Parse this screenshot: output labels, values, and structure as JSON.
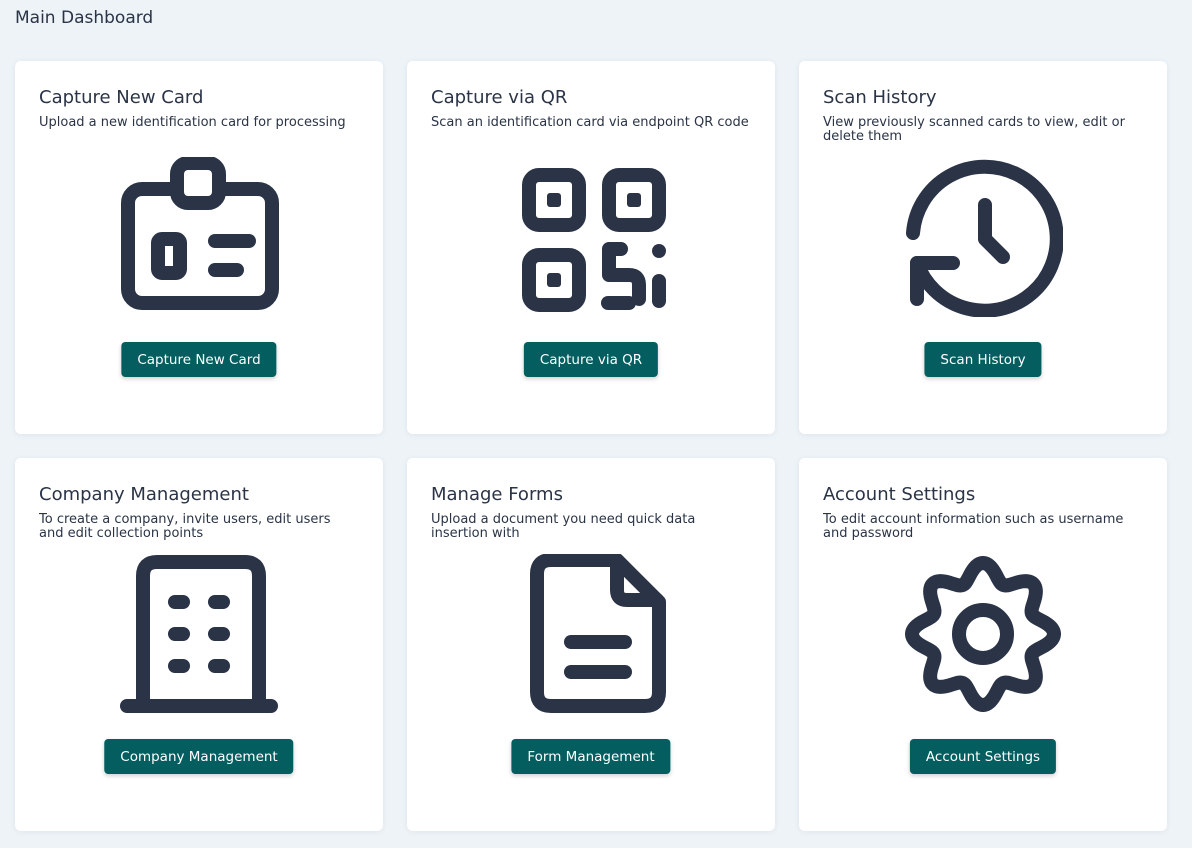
{
  "page": {
    "title": "Main Dashboard"
  },
  "cards": [
    {
      "title": "Capture New Card",
      "description": "Upload a new identification card for processing",
      "icon": "id-card-icon",
      "button": "Capture New Card"
    },
    {
      "title": "Capture via QR",
      "description": "Scan an identification card via endpoint QR code",
      "icon": "qr-code-icon",
      "button": "Capture via QR"
    },
    {
      "title": "Scan History",
      "description": "View previously scanned cards to view, edit or delete them",
      "icon": "history-icon",
      "button": "Scan History"
    },
    {
      "title": "Company Management",
      "description": "To create a company, invite users, edit users and edit collection points",
      "icon": "building-icon",
      "button": "Company Management"
    },
    {
      "title": "Manage Forms",
      "description": "Upload a document you need quick data insertion with",
      "icon": "document-icon",
      "button": "Form Management"
    },
    {
      "title": "Account Settings",
      "description": "To edit account information such as username and password",
      "icon": "gear-icon",
      "button": "Account Settings"
    }
  ],
  "colors": {
    "background": "#edf3f7",
    "card": "#ffffff",
    "button": "#045e60",
    "icon": "#2a3446"
  }
}
